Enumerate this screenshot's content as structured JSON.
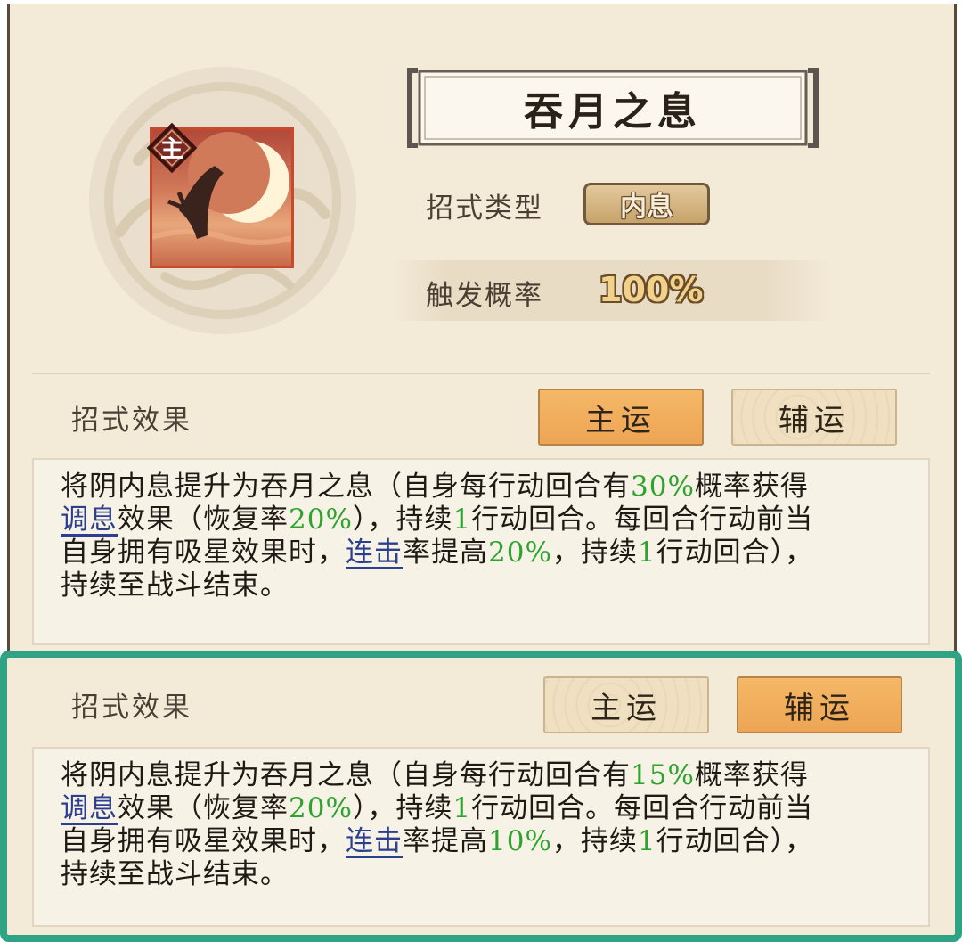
{
  "skill": {
    "name": "吞月之息",
    "main_badge": "主",
    "type_label": "招式类型",
    "type_value": "内息",
    "rate_label": "触发概率",
    "rate_value": "100%"
  },
  "top_section": {
    "title": "招式效果",
    "tabs": [
      {
        "label": "主运",
        "active": true
      },
      {
        "label": "辅运",
        "active": false
      }
    ],
    "description": {
      "p1": "将阴内息提升为吞月之息（自身每行动回合有",
      "v1": "30%",
      "p2": "概率获得",
      "link1": "调息",
      "p3": "效果（恢复率",
      "v2": "20%",
      "p4": "），持续",
      "v3": "1",
      "p5": "行动回合。每回合行动前当",
      "p6": "自身拥有吸星效果时，",
      "link2": "连击",
      "p7": "率提高",
      "v4": "20%",
      "p8": "，持续",
      "v5": "1",
      "p9": "行动回合），",
      "p10": "持续至战斗结束。"
    }
  },
  "bottom_section": {
    "title": "招式效果",
    "tabs": [
      {
        "label": "主运",
        "active": false
      },
      {
        "label": "辅运",
        "active": true
      }
    ],
    "description": {
      "p1": "将阴内息提升为吞月之息（自身每行动回合有",
      "v1": "15%",
      "p2": "概率获得",
      "link1": "调息",
      "p3": "效果（恢复率",
      "v2": "20%",
      "p4": "），持续",
      "v3": "1",
      "p5": "行动回合。每回合行动前当",
      "p6": "自身拥有吸星效果时，",
      "link2": "连击",
      "p7": "率提高",
      "v4": "10%",
      "p8": "，持续",
      "v5": "1",
      "p9": "行动回合），",
      "p10": "持续至战斗结束。"
    }
  },
  "colors": {
    "highlight_value": "#2fa32f",
    "link": "#2b3f8e",
    "active_tab": "#f0ad5c",
    "focus_border": "#2fa383"
  }
}
